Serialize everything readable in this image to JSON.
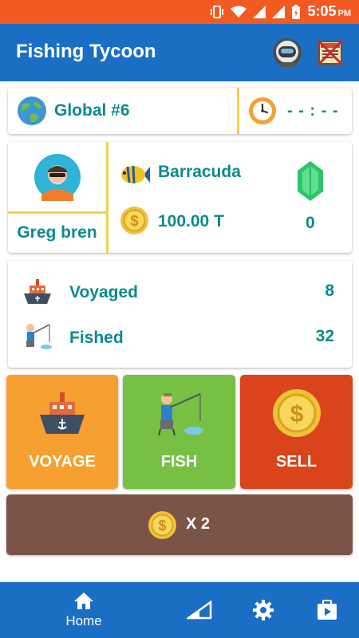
{
  "status_bar": {
    "time": "5:05",
    "ampm": "PM"
  },
  "app_bar": {
    "title": "Fishing Tycoon",
    "profile_icon": "astronaut-avatar-icon",
    "no_ads_icon": "no-ads-icon"
  },
  "rank": {
    "label": "Global #6",
    "timer": "- - : - -"
  },
  "player": {
    "name": "Greg bren",
    "fish_name": "Barracuda",
    "coins": "100.00 T",
    "gems": "0"
  },
  "stats": {
    "voyaged_label": "Voyaged",
    "voyaged_value": "8",
    "fished_label": "Fished",
    "fished_value": "32"
  },
  "actions": {
    "voyage": "VOYAGE",
    "fish": "FISH",
    "sell": "SELL",
    "multiplier": "X 2"
  },
  "bottom_nav": {
    "home": "Home"
  },
  "colors": {
    "status_bar": "#f25a22",
    "app_bar": "#1a6fc5",
    "teal_text": "#0d8a8c",
    "voyage": "#f5a030",
    "fish": "#77c043",
    "sell": "#d9441c",
    "multiplier": "#7a5447",
    "divider": "#f3d04a"
  }
}
